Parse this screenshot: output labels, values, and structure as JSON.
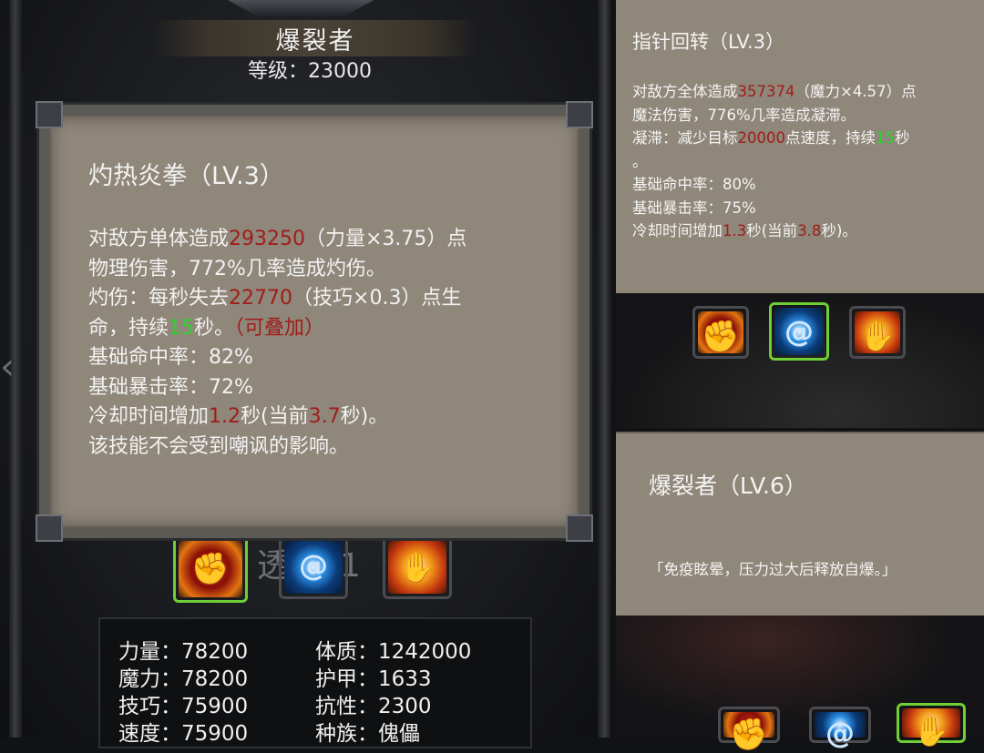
{
  "character": {
    "name": "爆裂者",
    "level_text": "等级：23000"
  },
  "main_tooltip": {
    "title": "灼热炎拳（LV.3）",
    "line1_a": "对敌方单体造成",
    "line1_b": "293250",
    "line1_c": "（力量×3.75）点",
    "line2": "物理伤害，772%几率造成灼伤。",
    "line3_a": "灼伤：每秒失去",
    "line3_b": "22770",
    "line3_c": "（技巧×0.3）点生",
    "line4_a": "命，持续",
    "line4_b": "15",
    "line4_c": "秒。",
    "line4_d": "（可叠加）",
    "line5": "基础命中率：82%",
    "line6": "基础暴击率：72%",
    "line7_a": "冷却时间增加",
    "line7_b": "1.2",
    "line7_c": "秒(当前",
    "line7_d": "3.7",
    "line7_e": "秒)。",
    "line8": "该技能不会受到嘲讽的影响。"
  },
  "faded_label": "透镜-1",
  "skills": [
    {
      "icon": "fist-skill-icon",
      "selected": true
    },
    {
      "icon": "swirl-skill-icon",
      "selected": false
    },
    {
      "icon": "burst-skill-icon",
      "selected": false
    }
  ],
  "stats": {
    "strength": "力量：78200",
    "magic": "魔力：78200",
    "skill": "技巧：75900",
    "speed": "速度：75900",
    "constitution": "体质：1242000",
    "armor": "护甲：1633",
    "resistance": "抗性：2300",
    "race": "种族：傀儡"
  },
  "right_tooltip": {
    "title": "指针回转（LV.3）",
    "l1_a": "对敌方全体造成",
    "l1_b": "357374",
    "l1_c": "（魔力×4.57）点",
    "l2": "魔法伤害，776%几率造成凝滞。",
    "l3_a": "凝滞：减少目标",
    "l3_b": "20000",
    "l3_c": "点速度，持续",
    "l3_d": "15",
    "l3_e": "秒",
    "l4": "。",
    "l5": "基础命中率：80%",
    "l6": "基础暴击率：75%",
    "l7_a": "冷却时间增加",
    "l7_b": "1.3",
    "l7_c": "秒(当前",
    "l7_d": "3.8",
    "l7_e": "秒)。"
  },
  "right_bottom": {
    "title": "爆裂者（LV.6）",
    "quote": "「免疫眩晕，压力过大后释放自爆。」"
  },
  "colors": {
    "parchment": "#8f877a",
    "damage_red": "#a01d1a",
    "duration_green": "#2fd12f",
    "selected_border": "#6ecf36"
  }
}
